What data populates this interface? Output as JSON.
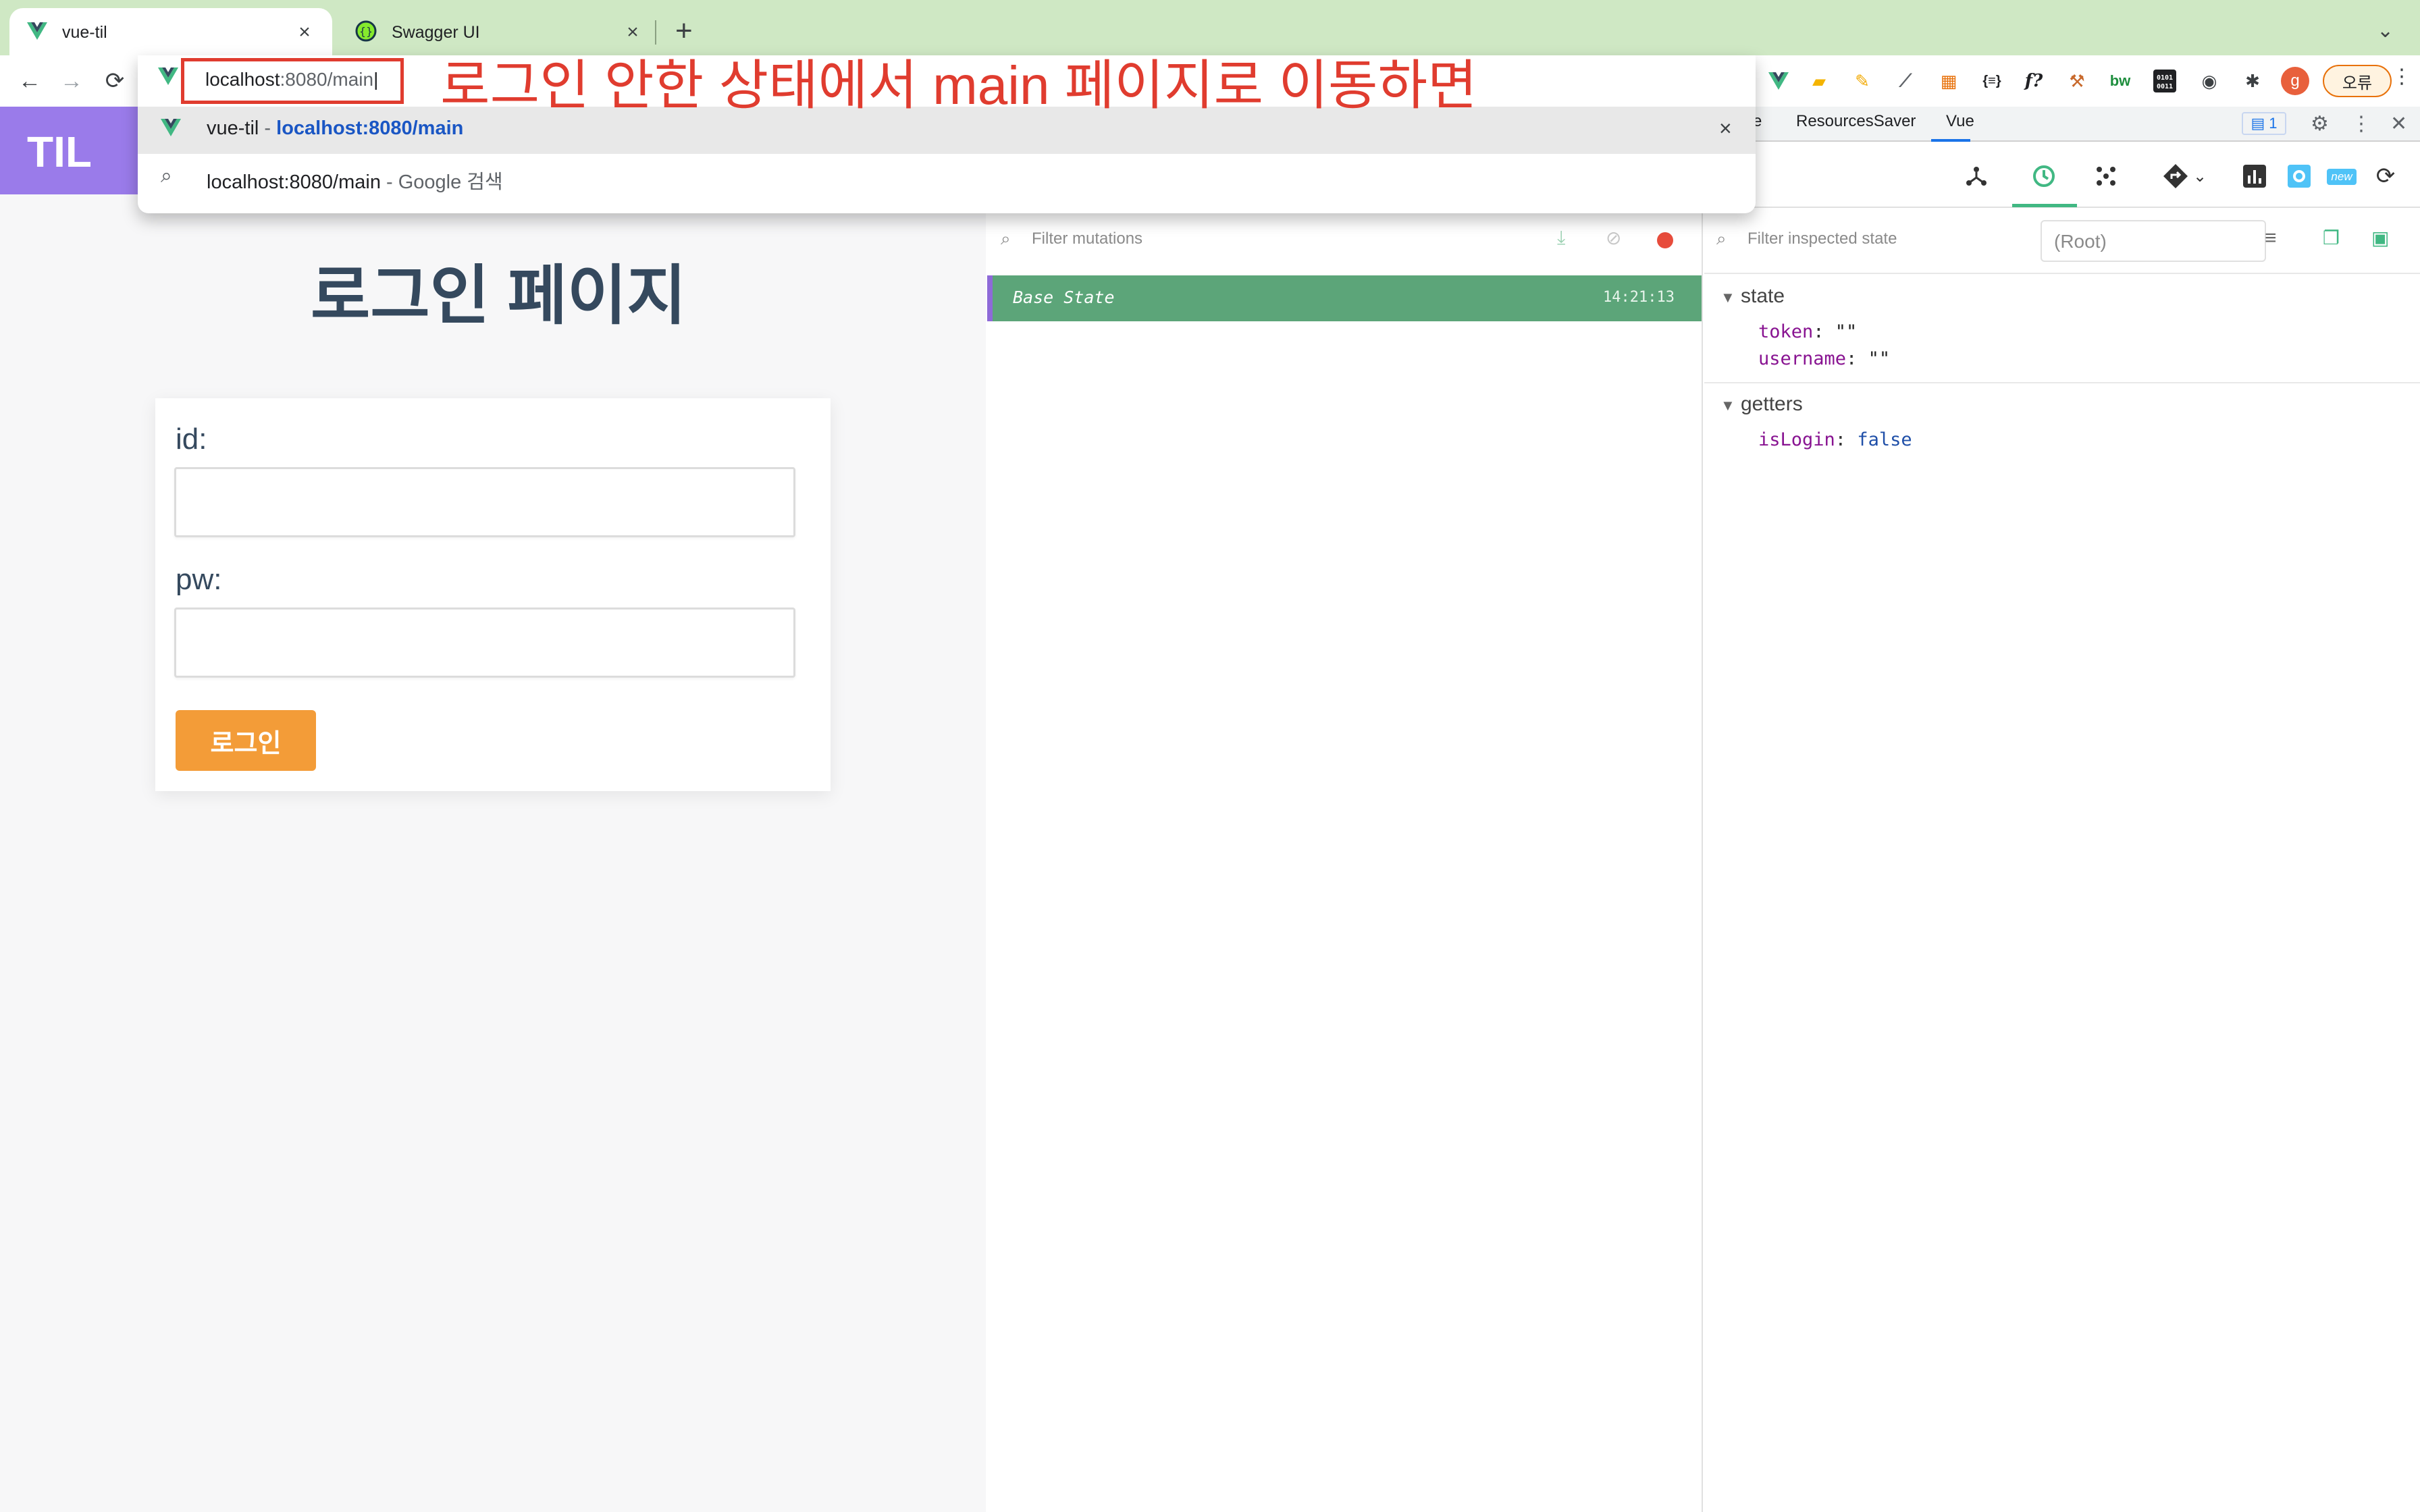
{
  "browser": {
    "tabs": [
      {
        "title": "vue-til",
        "icon": "vue-logo-icon",
        "active": true
      },
      {
        "title": "Swagger UI",
        "icon": "swagger-icon",
        "active": false
      }
    ],
    "new_tab": "+",
    "close_glyph": "×",
    "omnibox": {
      "typed_prefix": "localhost",
      "typed_rest": ":8080/main",
      "suggestions": [
        {
          "title": "vue-til",
          "separator": " - ",
          "url": "localhost:8080/main",
          "icon": "vue-logo-icon"
        },
        {
          "query": "localhost:8080/main",
          "separator": " - ",
          "engine": "Google 검색",
          "icon": "search-icon"
        }
      ]
    },
    "profile_initial": "g",
    "error_chip": "오류"
  },
  "annotation": "로그인 안한 상태에서 main 페이지로 이동하면",
  "app": {
    "logo": "TIL",
    "login_title": "로그인 페이지",
    "id_label": "id:",
    "pw_label": "pw:",
    "login_button": "로그인"
  },
  "devtools": {
    "tabs": [
      "e",
      "ResourcesSaver",
      "Vue"
    ],
    "issues_count": "1",
    "vue": {
      "filter_mutations_placeholder": "Filter mutations",
      "mutations": [
        {
          "label": "Base State",
          "time": "14:21:13"
        }
      ],
      "filter_state_placeholder": "Filter inspected state",
      "root_select": "(Root)",
      "new_badge": "new",
      "state": {
        "heading": "state",
        "entries": [
          {
            "key": "token",
            "value": "\"\""
          },
          {
            "key": "username",
            "value": "\"\""
          }
        ]
      },
      "getters": {
        "heading": "getters",
        "entries": [
          {
            "key": "isLogin",
            "value": "false"
          }
        ]
      }
    }
  },
  "colors": {
    "tabstrip": "#cfe8c4",
    "vue_green": "#41b883",
    "til_purple": "#9a7bea",
    "login_orange": "#f39c38",
    "annotation_red": "#e03c2f",
    "mutation_row": "#5ca579"
  }
}
